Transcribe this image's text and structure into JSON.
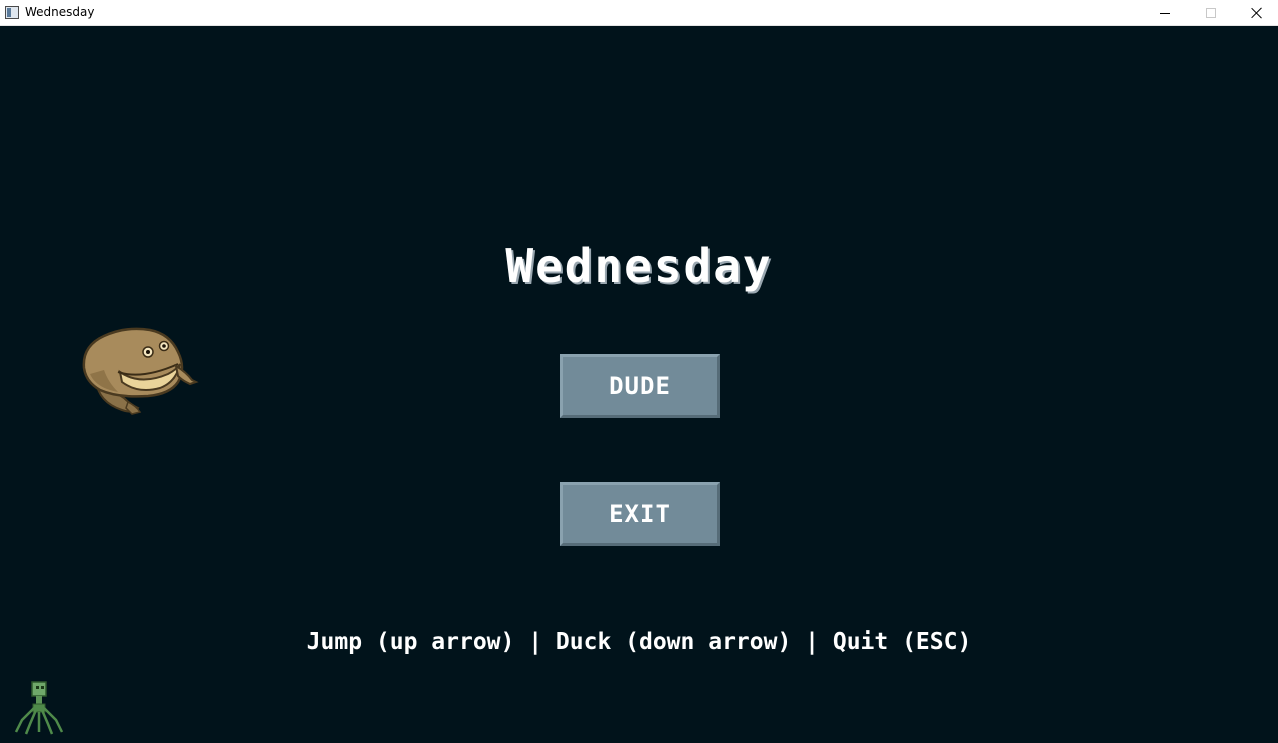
{
  "window": {
    "title": "Wednesday",
    "icon": "app-window-icon",
    "controls": [
      "minimize",
      "maximize",
      "close"
    ]
  },
  "game": {
    "background_color": "#01131b",
    "title": "Wednesday",
    "buttons": {
      "dude_label": "DUDE",
      "exit_label": "EXIT"
    },
    "button_color": "#728b99",
    "controls_hint": "Jump (up arrow) | Duck (down arrow) | Quit (ESC)",
    "sprites": {
      "player": "frog-sprite",
      "enemy": "green-spider-bug-sprite"
    }
  }
}
